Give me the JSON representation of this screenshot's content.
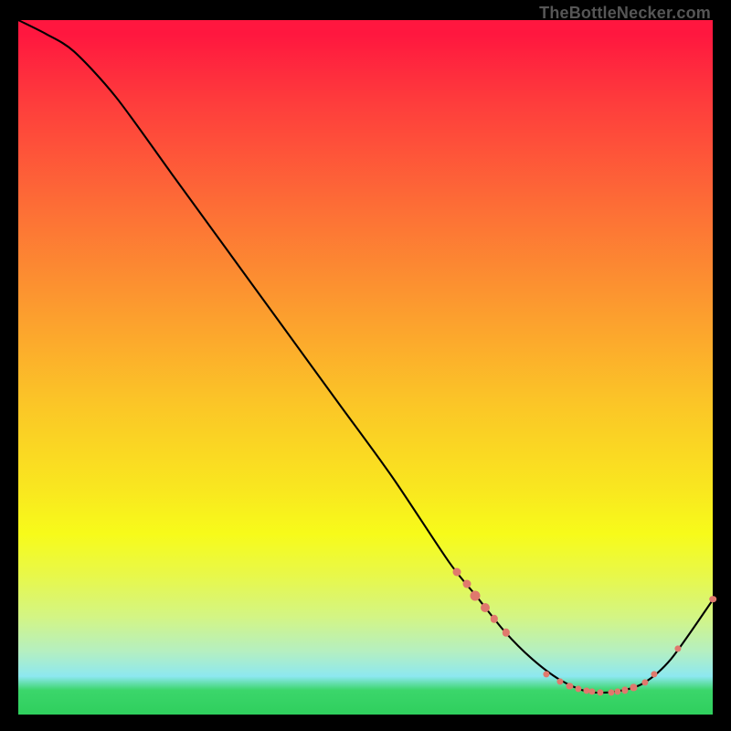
{
  "attribution": "TheBottleNecker.com",
  "colors": {
    "dot": "#e0796d",
    "curve": "#000000"
  },
  "chart_data": {
    "type": "line",
    "title": "",
    "xlabel": "",
    "ylabel": "",
    "xlim": [
      0,
      100
    ],
    "ylim": [
      0,
      100
    ],
    "x": [
      0,
      4,
      8,
      14,
      22,
      30,
      38,
      46,
      54,
      62,
      66,
      70,
      74,
      78,
      82,
      86,
      90,
      94,
      100
    ],
    "y": [
      100,
      98,
      95.5,
      89,
      78,
      67,
      56,
      45,
      34,
      22,
      17,
      12,
      8,
      5,
      3.3,
      3.3,
      4.5,
      8,
      16.5
    ],
    "dot_clusters": [
      {
        "x": 63.2,
        "y": 20.5,
        "r": 4.5
      },
      {
        "x": 64.6,
        "y": 18.8,
        "r": 4.5
      },
      {
        "x": 65.8,
        "y": 17.1,
        "r": 5.5
      },
      {
        "x": 67.2,
        "y": 15.4,
        "r": 5.0
      },
      {
        "x": 68.5,
        "y": 13.8,
        "r": 4.2
      },
      {
        "x": 70.2,
        "y": 11.8,
        "r": 4.2
      },
      {
        "x": 76.0,
        "y": 5.8,
        "r": 3.6
      },
      {
        "x": 78.0,
        "y": 4.8,
        "r": 3.6
      },
      {
        "x": 79.4,
        "y": 4.1,
        "r": 3.6
      },
      {
        "x": 80.6,
        "y": 3.7,
        "r": 3.6
      },
      {
        "x": 81.8,
        "y": 3.4,
        "r": 3.6
      },
      {
        "x": 82.6,
        "y": 3.3,
        "r": 3.6
      },
      {
        "x": 83.8,
        "y": 3.2,
        "r": 3.6
      },
      {
        "x": 85.4,
        "y": 3.2,
        "r": 3.6
      },
      {
        "x": 86.3,
        "y": 3.3,
        "r": 3.6
      },
      {
        "x": 87.4,
        "y": 3.5,
        "r": 3.6
      },
      {
        "x": 88.6,
        "y": 3.9,
        "r": 3.6
      },
      {
        "x": 90.2,
        "y": 4.6,
        "r": 3.6
      },
      {
        "x": 91.6,
        "y": 5.8,
        "r": 3.6
      },
      {
        "x": 95.0,
        "y": 9.5,
        "r": 3.6
      },
      {
        "x": 100.0,
        "y": 16.6,
        "r": 3.8
      }
    ]
  }
}
